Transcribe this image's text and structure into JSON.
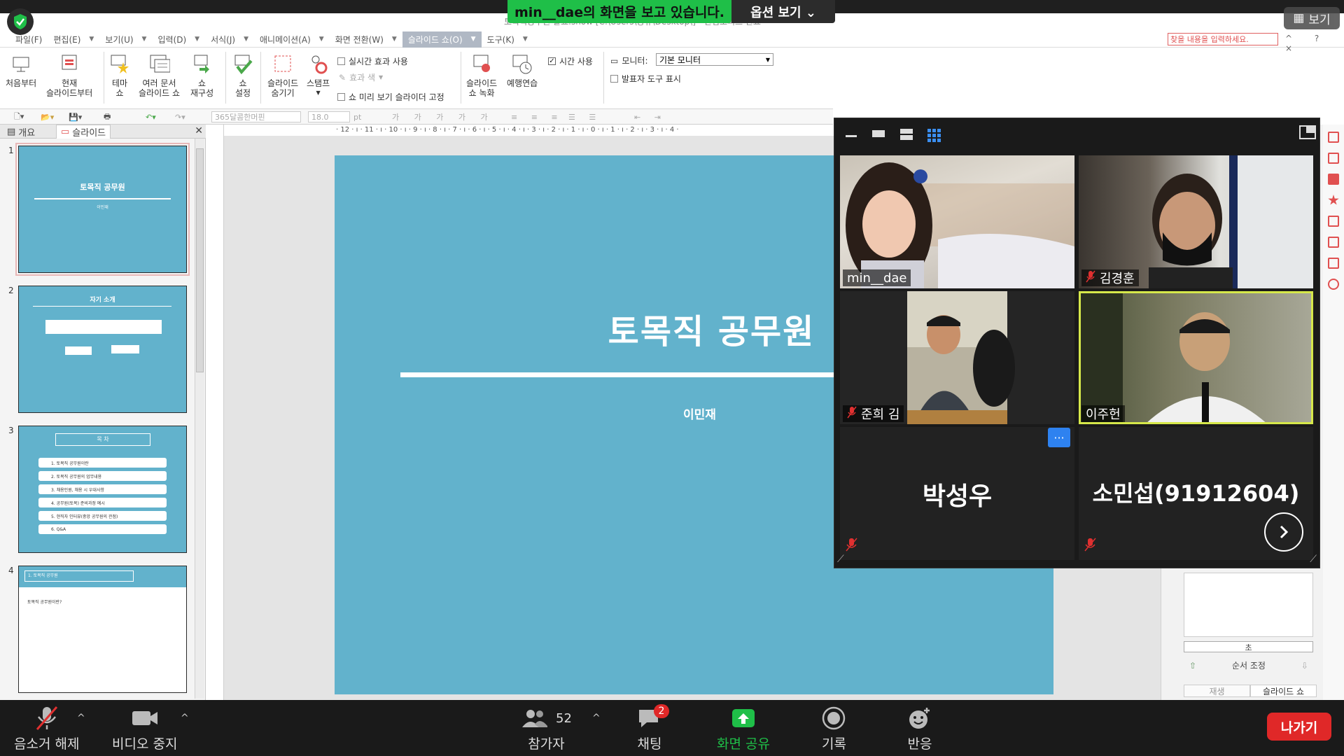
{
  "zoom_banner": {
    "sharing_text": "min__dae의 화면을 보고 있습니다.",
    "options_label": "옵션 보기 ⌄",
    "view_label": "보기"
  },
  "app": {
    "title_text": "토목직공무원 발표.show [C:\\Users\\공유\\Desktop\\] - 한컴오피스 한쇼",
    "search_placeholder": "찾을 내용을 입력하세요."
  },
  "menus": [
    "파일(F)",
    "편집(E)",
    "보기(U)",
    "입력(D)",
    "서식(J)",
    "애니메이션(A)",
    "화면 전환(W)",
    "슬라이드 쇼(O)",
    "도구(K)"
  ],
  "ribbon": {
    "from_start": "처음부터",
    "from_current": [
      "현재",
      "슬라이드부터"
    ],
    "theme_show": [
      "테마",
      "쇼"
    ],
    "multi_doc": [
      "여러 문서",
      "슬라이드 쇼"
    ],
    "show_rebuild": [
      "쇼",
      "재구성"
    ],
    "show_settings": [
      "쇼",
      "설정"
    ],
    "hide_slide": [
      "슬라이드",
      "숨기기"
    ],
    "stamp": "스탬프",
    "realtime_effect": "실시간 효과 사용",
    "effect_color": "효과 색",
    "preview_fix": "쇼 미리 보기 슬라이더 고정",
    "record": [
      "슬라이드",
      "쇼 녹화"
    ],
    "rehearse": "예행연습",
    "use_time": "시간 사용",
    "monitor_label": "모니터:",
    "monitor_value": "기본 모니터",
    "presenter_tools": "발표자 도구 표시"
  },
  "format_bar": {
    "font": "365달콤한머핀",
    "size": "18.0",
    "unit": "pt"
  },
  "left_panel": {
    "tabs": [
      "개요",
      "슬라이드"
    ],
    "thumbs": [
      {
        "num": "1",
        "title": "토목직 공무원",
        "sub": "이민재"
      },
      {
        "num": "2",
        "title": "자기 소개"
      },
      {
        "num": "3",
        "title": "목 차",
        "rows": [
          "1. 토목직 공무원이란",
          "2. 토목직 공무원의 업무내용",
          "3. 채용인원, 채용 시 우대사항",
          "4. 공무원(토목) 준비과정 예시",
          "5. 현직자 인터뷰(중앙 공무원의 관점)",
          "6. Q&A"
        ]
      },
      {
        "num": "4",
        "title": "1. 토목직 공무원",
        "body": "토목직 공무원이란?"
      }
    ]
  },
  "ruler_h": "· 12 · ı · 11 · ı · 10 · ı · 9 · ı · 8 · ı · 7 · ı · 6 · ı · 5 · ı · 4 · ı · 3 · ı · 2 · ı · 1 · ı · 0 · ı · 1 · ı · 2 · ı · 3 · ı · 4 ·",
  "slide": {
    "title": "토목직 공무원",
    "subtitle": "이민재"
  },
  "right_panel": {
    "unit": "초",
    "order_label": "순서 조정",
    "tabs": [
      "재생",
      "슬라이드 쇼"
    ]
  },
  "participants": [
    {
      "name": "min__dae",
      "muted": false
    },
    {
      "name": "김경훈",
      "muted": true
    },
    {
      "name": "준희 김",
      "muted": true
    },
    {
      "name": "이주헌",
      "muted": false,
      "active": true
    },
    {
      "name": "박성우",
      "muted": true
    },
    {
      "name": "소민섭(91912604)",
      "muted": true
    }
  ],
  "zoom_controls": {
    "unmute": "음소거 해제",
    "stop_video": "비디오 중지",
    "participants": "참가자",
    "participant_count": "52",
    "chat": "채팅",
    "chat_badge": "2",
    "share": "화면 공유",
    "record": "기록",
    "reactions": "반응",
    "leave": "나가기"
  },
  "colors": {
    "slide_bg": "#62b2cc",
    "share_green": "#1fbf48",
    "leave_red": "#e02828",
    "active_speaker": "#d6e84a"
  }
}
